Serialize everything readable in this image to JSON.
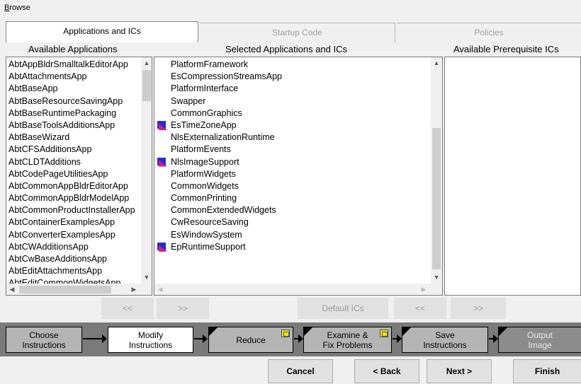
{
  "menu": {
    "browse_prefix": "B",
    "browse_rest": "rowse"
  },
  "tabs": [
    {
      "label": "Applications and ICs",
      "active": true
    },
    {
      "label": "Startup Code",
      "active": false
    },
    {
      "label": "Policies",
      "active": false
    }
  ],
  "headers": {
    "available_applications": "Available Applications",
    "selected_applications": "Selected Applications and ICs",
    "available_prerequisites": "Available Prerequisite ICs"
  },
  "available_applications": [
    "AbtAppBldrSmalltalkEditorApp",
    "AbtAttachmentsApp",
    "AbtBaseApp",
    "AbtBaseResourceSavingApp",
    "AbtBaseRuntimePackaging",
    "AbtBaseToolsAdditionsApp",
    "AbtBaseWizard",
    "AbtCFSAdditionsApp",
    "AbtCLDTAdditions",
    "AbtCodePageUtilitiesApp",
    "AbtCommonAppBldrEditorApp",
    "AbtCommonAppBldrModelApp",
    "AbtCommonProductInstallerApp",
    "AbtContainerExamplesApp",
    "AbtConverterExamplesApp",
    "AbtCWAdditionsApp",
    "AbtCwBaseAdditionsApp",
    "AbtEditAttachmentsApp",
    "AbtEditCommonWidgetsApp"
  ],
  "selected_applications": [
    {
      "name": "PlatformFramework",
      "ic": false
    },
    {
      "name": "EsCompressionStreamsApp",
      "ic": false
    },
    {
      "name": "PlatformInterface",
      "ic": false
    },
    {
      "name": "Swapper",
      "ic": false
    },
    {
      "name": "CommonGraphics",
      "ic": false
    },
    {
      "name": "EsTimeZoneApp",
      "ic": true
    },
    {
      "name": "NlsExternalizationRuntime",
      "ic": false
    },
    {
      "name": "PlatformEvents",
      "ic": false
    },
    {
      "name": "NlsImageSupport",
      "ic": true
    },
    {
      "name": "PlatformWidgets",
      "ic": false
    },
    {
      "name": "CommonWidgets",
      "ic": false
    },
    {
      "name": "CommonPrinting",
      "ic": false
    },
    {
      "name": "CommonExtendedWidgets",
      "ic": false
    },
    {
      "name": "CwResourceSaving",
      "ic": false
    },
    {
      "name": "EsWindowSystem",
      "ic": false
    },
    {
      "name": "EpRuntimeSupport",
      "ic": true
    }
  ],
  "available_prerequisites": [],
  "list_buttons": {
    "remove": "<<",
    "add": ">>",
    "default_ics": "Default ICs",
    "prereq_remove": "<<",
    "prereq_add": ">>"
  },
  "workflow": [
    {
      "label_line1": "Choose",
      "label_line2": "Instructions",
      "state": "done"
    },
    {
      "label_line1": "Modify",
      "label_line2": "Instructions",
      "state": "current"
    },
    {
      "label_line1": "Reduce",
      "label_line2": "",
      "state": "done",
      "flag": true
    },
    {
      "label_line1": "Examine &",
      "label_line2": "Fix Problems",
      "state": "done",
      "flag": true
    },
    {
      "label_line1": "Save",
      "label_line2": "Instructions",
      "state": "done"
    },
    {
      "label_line1": "Output",
      "label_line2": "Image",
      "state": "pending"
    }
  ],
  "dialog_buttons": {
    "cancel": "Cancel",
    "back": "< Back",
    "next": "Next >",
    "finish": "Finish"
  },
  "colors": {
    "ic_icon_blue": "#2a2ad0",
    "ic_icon_pink": "#d02080",
    "flag_yellow": "#f2e600",
    "workflow_bg": "#7a7a7a"
  }
}
